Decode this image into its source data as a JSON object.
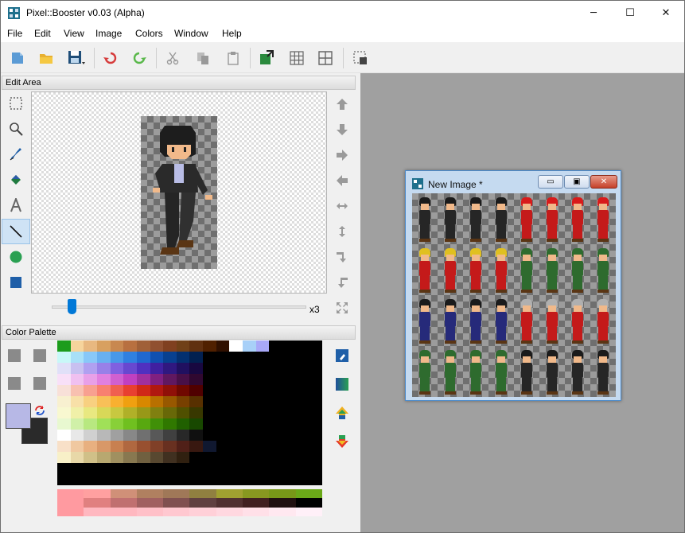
{
  "window": {
    "title": "Pixel::Booster v0.03 (Alpha)",
    "minimize_glyph": "─",
    "maximize_glyph": "☐",
    "close_glyph": "✕"
  },
  "menu": [
    "File",
    "Edit",
    "View",
    "Image",
    "Colors",
    "Window",
    "Help"
  ],
  "toolbar": {
    "icons": [
      "new-icon",
      "open-icon",
      "save-icon",
      "undo-icon",
      "redo-icon",
      "cut-icon",
      "copy-icon",
      "paste-icon",
      "image-size-icon",
      "grid-icon",
      "tile-grid-icon",
      "selection-icon"
    ]
  },
  "edit_area": {
    "title": "Edit Area",
    "zoom_label": "x3",
    "zoom_slider_fraction": 0.07
  },
  "tools": [
    "rect-select-icon",
    "zoom-icon",
    "pen-icon",
    "fill-icon",
    "text-icon",
    "line-icon",
    "ellipse-icon",
    "rectangle-icon"
  ],
  "selected_tool": "line-icon",
  "shift_arrows": [
    "arrow-up-icon",
    "arrow-down-icon",
    "arrow-right-icon",
    "arrow-left-icon",
    "flip-horizontal-icon",
    "flip-vertical-icon",
    "rotate-right-icon",
    "rotate-left-icon",
    "fit-icon"
  ],
  "color_palette": {
    "title": "Color Palette",
    "foreground": "#b7b8e6",
    "background": "#2a2a2a",
    "tool_icons": [
      "color-picker-icon",
      "gradient-icon",
      "brighten-icon",
      "darken-icon"
    ]
  },
  "palette_rows": [
    [
      "#1c9c1c",
      "#f6d49c",
      "#e8b880",
      "#d8a060",
      "#c88850",
      "#b87040",
      "#a06038",
      "#905030",
      "#804020",
      "#704018",
      "#603010",
      "#502000",
      "#301000",
      "#ffffff",
      "#a8d0f8",
      "#a8a8f8",
      "#000000",
      "#000000",
      "#000000",
      "#000000"
    ],
    [
      "#c8f8f8",
      "#a8e0f8",
      "#88c8f8",
      "#68b0f0",
      "#4898e8",
      "#3080e0",
      "#2068d0",
      "#1050b0",
      "#084090",
      "#043070",
      "#022050",
      "#000000",
      "#000000",
      "#000000",
      "#000000",
      "#000000",
      "#000000",
      "#000000",
      "#000000",
      "#000000"
    ],
    [
      "#e0e0f8",
      "#c8c0f0",
      "#b0a0f0",
      "#9880e8",
      "#8060e0",
      "#6848d0",
      "#5030c0",
      "#4020a0",
      "#301880",
      "#201060",
      "#180840",
      "#000000",
      "#000000",
      "#000000",
      "#000000",
      "#000000",
      "#000000",
      "#000000",
      "#000000",
      "#000000"
    ],
    [
      "#f8e0f8",
      "#f0c0f0",
      "#e8a0e8",
      "#e080e0",
      "#d060d0",
      "#c040c0",
      "#a030a0",
      "#802080",
      "#601860",
      "#481048",
      "#300830",
      "#000000",
      "#000000",
      "#000000",
      "#000000",
      "#000000",
      "#000000",
      "#000000",
      "#000000",
      "#000000"
    ],
    [
      "#f8e0d8",
      "#f8c0b0",
      "#f8a090",
      "#f88070",
      "#f06050",
      "#e84030",
      "#d02818",
      "#b01810",
      "#901008",
      "#700800",
      "#500000",
      "#000000",
      "#000000",
      "#000000",
      "#000000",
      "#000000",
      "#000000",
      "#000000",
      "#000000",
      "#000000"
    ],
    [
      "#f8f0d0",
      "#f8e0a8",
      "#f8d080",
      "#f8c058",
      "#f8b030",
      "#f0a010",
      "#d88800",
      "#b87000",
      "#985800",
      "#784000",
      "#583000",
      "#000000",
      "#000000",
      "#000000",
      "#000000",
      "#000000",
      "#000000",
      "#000000",
      "#000000",
      "#000000"
    ],
    [
      "#f8f8d0",
      "#f0f0a8",
      "#e8e880",
      "#d8d858",
      "#c8c840",
      "#b0b028",
      "#989818",
      "#808010",
      "#686808",
      "#505000",
      "#383800",
      "#000000",
      "#000000",
      "#000000",
      "#000000",
      "#000000",
      "#000000",
      "#000000",
      "#000000",
      "#000000"
    ],
    [
      "#e8f8d0",
      "#d0f0a8",
      "#b8e880",
      "#a0e058",
      "#88d038",
      "#70c020",
      "#58a810",
      "#409008",
      "#307800",
      "#206000",
      "#184800",
      "#000000",
      "#000000",
      "#000000",
      "#000000",
      "#000000",
      "#000000",
      "#000000",
      "#000000",
      "#000000"
    ],
    [
      "#ffffff",
      "#e8e8e8",
      "#d0d0d0",
      "#b8b8b8",
      "#a0a0a0",
      "#888888",
      "#707070",
      "#585858",
      "#404040",
      "#282828",
      "#101010",
      "#000000",
      "#000000",
      "#000000",
      "#000000",
      "#000000",
      "#000000",
      "#000000",
      "#000000",
      "#000000"
    ],
    [
      "#f8e0c8",
      "#f0c8a0",
      "#e8b080",
      "#d89868",
      "#c88050",
      "#b06840",
      "#985030",
      "#804028",
      "#683020",
      "#502018",
      "#381810",
      "#101830",
      "#000000",
      "#000000",
      "#000000",
      "#000000",
      "#000000",
      "#000000",
      "#000000",
      "#000000"
    ],
    [
      "#f8f0c8",
      "#e8d8a8",
      "#d0c088",
      "#b8a870",
      "#a09060",
      "#887850",
      "#706040",
      "#584830",
      "#403020",
      "#302010",
      "#000000",
      "#000000",
      "#000000",
      "#000000",
      "#000000",
      "#000000",
      "#000000",
      "#000000",
      "#000000",
      "#000000"
    ],
    [
      "#000000",
      "#000000",
      "#000000",
      "#000000",
      "#000000",
      "#000000",
      "#000000",
      "#000000",
      "#000000",
      "#000000",
      "#000000",
      "#000000",
      "#000000",
      "#000000",
      "#000000",
      "#000000",
      "#000000",
      "#000000",
      "#000000",
      "#000000"
    ],
    [
      "#000000",
      "#000000",
      "#000000",
      "#000000",
      "#000000",
      "#000000",
      "#000000",
      "#000000",
      "#000000",
      "#000000",
      "#000000",
      "#000000",
      "#000000",
      "#000000",
      "#000000",
      "#000000",
      "#000000",
      "#000000",
      "#000000",
      "#000000"
    ]
  ],
  "palette2_rows": [
    [
      "#ff9aa0",
      "#ffa0a0",
      "#d09078",
      "#b08060",
      "#a07858",
      "#908040",
      "#a0a030",
      "#889820",
      "#789818",
      "#6aa818"
    ],
    [
      "#ff9aa0",
      "#e08080",
      "#c07070",
      "#a06060",
      "#805050",
      "#604040",
      "#503030",
      "#402020",
      "#201010",
      "#000000"
    ],
    [
      "#ff9aa0",
      "#ffb8c0",
      "#ffb8c0",
      "#ffc0c8",
      "#ffc8d0",
      "#ffd0d8",
      "#ffd8e0",
      "#ffe0e8",
      "#ffe8f0",
      "#fff0f8"
    ]
  ],
  "child_window": {
    "title": "New Image *",
    "minimize_glyph": "▭",
    "maximize_glyph": "▣",
    "close_glyph": "✕"
  },
  "sprite_sheet": {
    "rows": [
      [
        "#1b1b1b",
        "#1b1b1b",
        "#1b1b1b",
        "#1b1b1b",
        "#d81b1b",
        "#d81b1b",
        "#d81b1b",
        "#d81b1b"
      ],
      [
        "#e0c020",
        "#e0c020",
        "#e0c020",
        "#e0c020",
        "#2e6b2e",
        "#2e6b2e",
        "#2e6b2e",
        "#2e6b2e"
      ],
      [
        "#1b1b1b",
        "#1b1b1b",
        "#1b1b1b",
        "#1b1b1b",
        "#b0b0b0",
        "#b0b0b0",
        "#b0b0b0",
        "#b0b0b0"
      ],
      [
        "#2e6b2e",
        "#2e6b2e",
        "#2e6b2e",
        "#2e6b2e",
        "#1b1b1b",
        "#1b1b1b",
        "#1b1b1b",
        "#1b1b1b"
      ]
    ],
    "body_rows": [
      [
        "#262626",
        "#262626",
        "#262626",
        "#262626",
        "#c41a1a",
        "#c41a1a",
        "#c41a1a",
        "#c41a1a"
      ],
      [
        "#c41a1a",
        "#c41a1a",
        "#c41a1a",
        "#c41a1a",
        "#2e6b2e",
        "#2e6b2e",
        "#2e6b2e",
        "#2e6b2e"
      ],
      [
        "#262a7a",
        "#262a7a",
        "#262a7a",
        "#262a7a",
        "#c41a1a",
        "#c41a1a",
        "#c41a1a",
        "#c41a1a"
      ],
      [
        "#2e6b2e",
        "#2e6b2e",
        "#2e6b2e",
        "#2e6b2e",
        "#262626",
        "#262626",
        "#262626",
        "#262626"
      ]
    ]
  }
}
